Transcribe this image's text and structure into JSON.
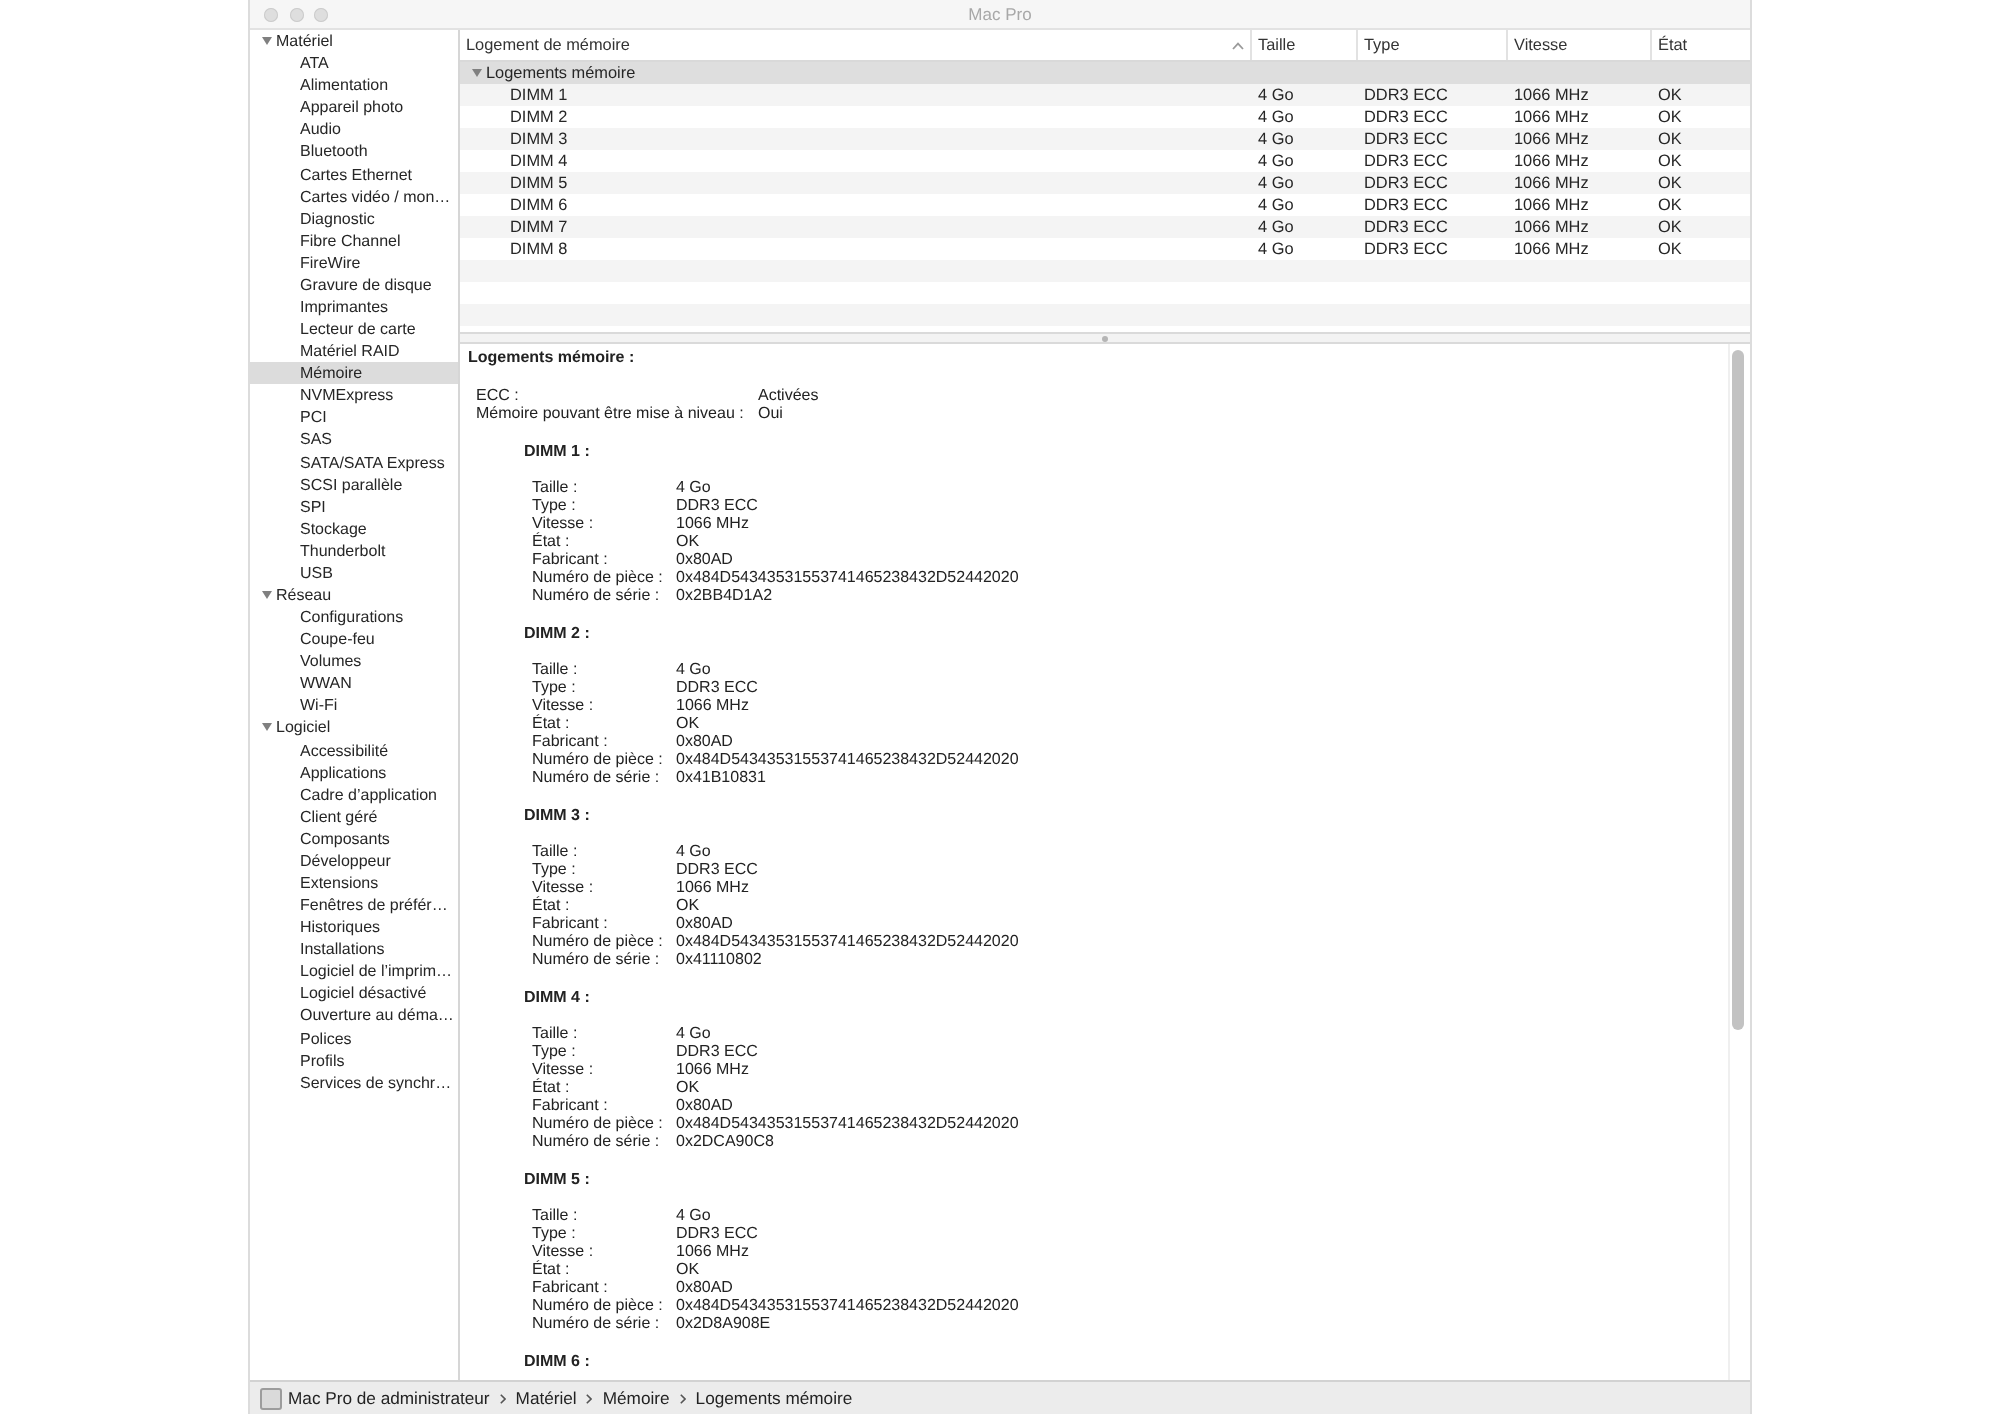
{
  "window": {
    "title": "Mac Pro"
  },
  "sidebar": {
    "items": [
      {
        "label": "Matériel",
        "expanded": true,
        "selected": false,
        "children": [
          {
            "label": "ATA",
            "selected": false
          },
          {
            "label": "Alimentation",
            "selected": false
          },
          {
            "label": "Appareil photo",
            "selected": false
          },
          {
            "label": "Audio",
            "selected": false
          },
          {
            "label": "Bluetooth",
            "selected": false
          },
          {
            "label": "Cartes Ethernet",
            "selected": false
          },
          {
            "label": "Cartes vidéo / mon…",
            "selected": false
          },
          {
            "label": "Diagnostic",
            "selected": false
          },
          {
            "label": "Fibre Channel",
            "selected": false
          },
          {
            "label": "FireWire",
            "selected": false
          },
          {
            "label": "Gravure de disque",
            "selected": false
          },
          {
            "label": "Imprimantes",
            "selected": false
          },
          {
            "label": "Lecteur de carte",
            "selected": false
          },
          {
            "label": "Matériel RAID",
            "selected": false
          },
          {
            "label": "Mémoire",
            "selected": true
          },
          {
            "label": "NVMExpress",
            "selected": false
          },
          {
            "label": "PCI",
            "selected": false
          },
          {
            "label": "SAS",
            "selected": false
          },
          {
            "label": "SATA/SATA Express",
            "selected": false
          },
          {
            "label": "SCSI parallèle",
            "selected": false
          },
          {
            "label": "SPI",
            "selected": false
          },
          {
            "label": "Stockage",
            "selected": false
          },
          {
            "label": "Thunderbolt",
            "selected": false
          },
          {
            "label": "USB",
            "selected": false
          }
        ]
      },
      {
        "label": "Réseau",
        "expanded": true,
        "selected": false,
        "children": [
          {
            "label": "Configurations",
            "selected": false
          },
          {
            "label": "Coupe-feu",
            "selected": false
          },
          {
            "label": "Volumes",
            "selected": false
          },
          {
            "label": "WWAN",
            "selected": false
          },
          {
            "label": "Wi-Fi",
            "selected": false
          }
        ]
      },
      {
        "label": "Logiciel",
        "expanded": true,
        "selected": false,
        "children": [
          {
            "label": "Accessibilité",
            "selected": false
          },
          {
            "label": "Applications",
            "selected": false
          },
          {
            "label": "Cadre d’application",
            "selected": false
          },
          {
            "label": "Client géré",
            "selected": false
          },
          {
            "label": "Composants",
            "selected": false
          },
          {
            "label": "Développeur",
            "selected": false
          },
          {
            "label": "Extensions",
            "selected": false
          },
          {
            "label": "Fenêtres de préfér…",
            "selected": false
          },
          {
            "label": "Historiques",
            "selected": false
          },
          {
            "label": "Installations",
            "selected": false
          },
          {
            "label": "Logiciel de l’imprim…",
            "selected": false
          },
          {
            "label": "Logiciel désactivé",
            "selected": false
          },
          {
            "label": "Ouverture au déma…",
            "selected": false
          },
          {
            "label": "Polices",
            "selected": false
          },
          {
            "label": "Profils",
            "selected": false
          },
          {
            "label": "Services de synchr…",
            "selected": false
          }
        ]
      }
    ]
  },
  "table": {
    "columns": [
      {
        "label": "Logement de mémoire",
        "sorted": true
      },
      {
        "label": "Taille",
        "sorted": false
      },
      {
        "label": "Type",
        "sorted": false
      },
      {
        "label": "Vitesse",
        "sorted": false
      },
      {
        "label": "État",
        "sorted": false
      }
    ],
    "groups": [
      {
        "label": "Logements mémoire",
        "expanded": true,
        "selected": false,
        "rows": [
          {
            "selected": false,
            "cells": [
              "DIMM 1",
              "4 Go",
              "DDR3 ECC",
              "1066 MHz",
              "OK"
            ]
          },
          {
            "selected": false,
            "cells": [
              "DIMM 2",
              "4 Go",
              "DDR3 ECC",
              "1066 MHz",
              "OK"
            ]
          },
          {
            "selected": false,
            "cells": [
              "DIMM 3",
              "4 Go",
              "DDR3 ECC",
              "1066 MHz",
              "OK"
            ]
          },
          {
            "selected": false,
            "cells": [
              "DIMM 4",
              "4 Go",
              "DDR3 ECC",
              "1066 MHz",
              "OK"
            ]
          },
          {
            "selected": false,
            "cells": [
              "DIMM 5",
              "4 Go",
              "DDR3 ECC",
              "1066 MHz",
              "OK"
            ]
          },
          {
            "selected": false,
            "cells": [
              "DIMM 6",
              "4 Go",
              "DDR3 ECC",
              "1066 MHz",
              "OK"
            ]
          },
          {
            "selected": false,
            "cells": [
              "DIMM 7",
              "4 Go",
              "DDR3 ECC",
              "1066 MHz",
              "OK"
            ]
          },
          {
            "selected": false,
            "cells": [
              "DIMM 8",
              "4 Go",
              "DDR3 ECC",
              "1066 MHz",
              "OK"
            ]
          }
        ]
      }
    ]
  },
  "detail": {
    "title": "Logements mémoire :",
    "summary": [
      {
        "label": "ECC :",
        "value": "Activées"
      },
      {
        "label": "Mémoire pouvant être mise à niveau :",
        "value": "Oui"
      }
    ],
    "modules": [
      {
        "title": "DIMM 1 :",
        "fields": [
          {
            "label": "Taille :",
            "value": "4 Go"
          },
          {
            "label": "Type :",
            "value": "DDR3 ECC"
          },
          {
            "label": "Vitesse :",
            "value": "1066 MHz"
          },
          {
            "label": "État :",
            "value": "OK"
          },
          {
            "label": "Fabricant :",
            "value": "0x80AD"
          },
          {
            "label": "Numéro de pièce :",
            "value": "0x484D54343531553741465238432D52442020"
          },
          {
            "label": "Numéro de série :",
            "value": "0x2BB4D1A2"
          }
        ]
      },
      {
        "title": "DIMM 2 :",
        "fields": [
          {
            "label": "Taille :",
            "value": "4 Go"
          },
          {
            "label": "Type :",
            "value": "DDR3 ECC"
          },
          {
            "label": "Vitesse :",
            "value": "1066 MHz"
          },
          {
            "label": "État :",
            "value": "OK"
          },
          {
            "label": "Fabricant :",
            "value": "0x80AD"
          },
          {
            "label": "Numéro de pièce :",
            "value": "0x484D54343531553741465238432D52442020"
          },
          {
            "label": "Numéro de série :",
            "value": "0x41B10831"
          }
        ]
      },
      {
        "title": "DIMM 3 :",
        "fields": [
          {
            "label": "Taille :",
            "value": "4 Go"
          },
          {
            "label": "Type :",
            "value": "DDR3 ECC"
          },
          {
            "label": "Vitesse :",
            "value": "1066 MHz"
          },
          {
            "label": "État :",
            "value": "OK"
          },
          {
            "label": "Fabricant :",
            "value": "0x80AD"
          },
          {
            "label": "Numéro de pièce :",
            "value": "0x484D54343531553741465238432D52442020"
          },
          {
            "label": "Numéro de série :",
            "value": "0x41110802"
          }
        ]
      },
      {
        "title": "DIMM 4 :",
        "fields": [
          {
            "label": "Taille :",
            "value": "4 Go"
          },
          {
            "label": "Type :",
            "value": "DDR3 ECC"
          },
          {
            "label": "Vitesse :",
            "value": "1066 MHz"
          },
          {
            "label": "État :",
            "value": "OK"
          },
          {
            "label": "Fabricant :",
            "value": "0x80AD"
          },
          {
            "label": "Numéro de pièce :",
            "value": "0x484D54343531553741465238432D52442020"
          },
          {
            "label": "Numéro de série :",
            "value": "0x2DCA90C8"
          }
        ]
      },
      {
        "title": "DIMM 5 :",
        "fields": [
          {
            "label": "Taille :",
            "value": "4 Go"
          },
          {
            "label": "Type :",
            "value": "DDR3 ECC"
          },
          {
            "label": "Vitesse :",
            "value": "1066 MHz"
          },
          {
            "label": "État :",
            "value": "OK"
          },
          {
            "label": "Fabricant :",
            "value": "0x80AD"
          },
          {
            "label": "Numéro de pièce :",
            "value": "0x484D54343531553741465238432D52442020"
          },
          {
            "label": "Numéro de série :",
            "value": "0x2D8A908E"
          }
        ]
      },
      {
        "title": "DIMM 6 :"
      }
    ]
  },
  "status_bar": {
    "path": [
      "Mac Pro de administrateur",
      "Matériel",
      "Mémoire",
      "Logements mémoire"
    ]
  }
}
